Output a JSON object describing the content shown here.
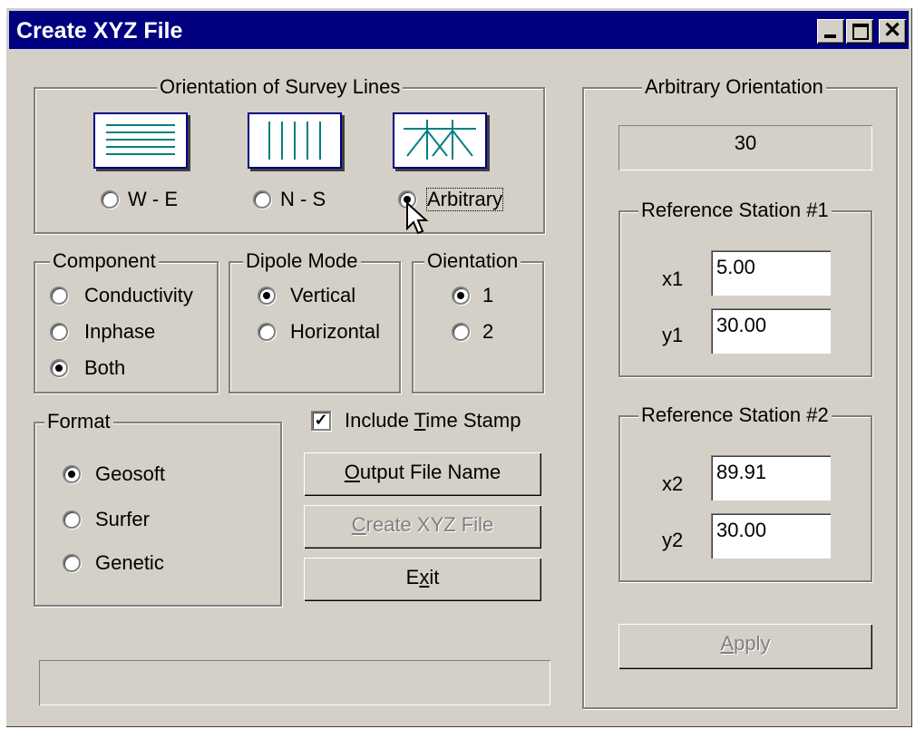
{
  "window": {
    "title": "Create XYZ File"
  },
  "survey_lines": {
    "legend": "Orientation of Survey Lines",
    "options": [
      {
        "label": "W - E",
        "selected": false
      },
      {
        "label": "N - S",
        "selected": false
      },
      {
        "label": "Arbitrary",
        "selected": true
      }
    ]
  },
  "component": {
    "legend": "Component",
    "options": [
      {
        "label": "Conductivity",
        "selected": false
      },
      {
        "label": "Inphase",
        "selected": false
      },
      {
        "label": "Both",
        "selected": true
      }
    ]
  },
  "dipole_mode": {
    "legend": "Dipole Mode",
    "options": [
      {
        "label": "Vertical",
        "selected": true
      },
      {
        "label": "Horizontal",
        "selected": false
      }
    ]
  },
  "orientation": {
    "legend": "Oientation",
    "options": [
      {
        "label": "1",
        "selected": true
      },
      {
        "label": "2",
        "selected": false
      }
    ]
  },
  "format": {
    "legend": "Format",
    "options": [
      {
        "label": "Geosoft",
        "selected": true
      },
      {
        "label": "Surfer",
        "selected": false
      },
      {
        "label": "Genetic",
        "selected": false
      }
    ]
  },
  "timestamp": {
    "pre": "Include ",
    "hot": "T",
    "post": "ime Stamp",
    "checked": true
  },
  "buttons": {
    "output": {
      "hot": "O",
      "rest": "utput File Name"
    },
    "create": {
      "hot": "C",
      "rest": "reate XYZ File",
      "enabled": false
    },
    "exit": {
      "pre": "E",
      "hot": "x",
      "post": "it"
    },
    "apply": {
      "hot": "A",
      "rest": "pply",
      "enabled": false
    }
  },
  "arbitrary": {
    "legend": "Arbitrary Orientation",
    "value": "30"
  },
  "ref1": {
    "legend": "Reference Station #1",
    "x_label": "x1",
    "x_value": "5.00",
    "y_label": "y1",
    "y_value": "30.00"
  },
  "ref2": {
    "legend": "Reference Station #2",
    "x_label": "x2",
    "x_value": "89.91",
    "y_label": "y2",
    "y_value": "30.00"
  },
  "colors": {
    "titlebar": "#000080",
    "face": "#d4d0c8",
    "icon_lines": "#008080"
  }
}
